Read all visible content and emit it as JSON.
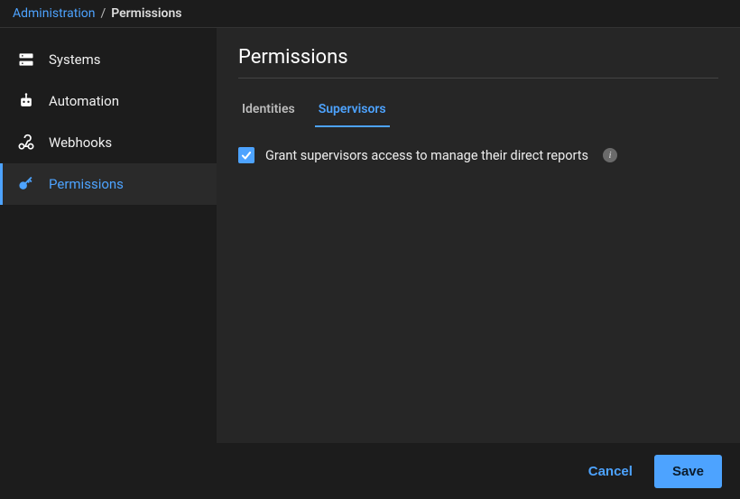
{
  "breadcrumb": {
    "parent": "Administration",
    "separator": "/",
    "current": "Permissions"
  },
  "sidebar": {
    "items": [
      {
        "label": "Systems"
      },
      {
        "label": "Automation"
      },
      {
        "label": "Webhooks"
      },
      {
        "label": "Permissions"
      }
    ]
  },
  "main": {
    "title": "Permissions",
    "tabs": [
      {
        "label": "Identities"
      },
      {
        "label": "Supervisors"
      }
    ],
    "checkbox_label": "Grant supervisors access to manage their direct reports",
    "info_glyph": "i"
  },
  "footer": {
    "cancel": "Cancel",
    "save": "Save"
  }
}
